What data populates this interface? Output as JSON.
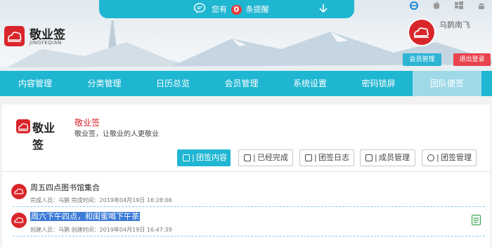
{
  "notification": {
    "prefix": "您有",
    "count": "0",
    "suffix": "条提醒"
  },
  "brand": {
    "name": "敬业签",
    "sub": "JINGYEQIAN"
  },
  "os_icons": [
    "ie-icon",
    "apple-icon",
    "windows-icon",
    "android-icon"
  ],
  "user": {
    "name": "乌鹊南飞",
    "member_button": "会员管理",
    "logout_button": "退出登录"
  },
  "nav": {
    "items": [
      "内容管理",
      "分类管理",
      "日历总览",
      "会员管理",
      "系统设置",
      "密码锁屏",
      "团队便签"
    ],
    "active_index": 6
  },
  "app": {
    "name": "敬业签",
    "desc": "敬业签，让敬业的人更敬业",
    "logo_text": "敬业签"
  },
  "tabs": [
    {
      "label": "团签内容",
      "active": true
    },
    {
      "label": "已经完成",
      "active": false
    },
    {
      "label": "团签日志",
      "active": false
    },
    {
      "label": "成员管理",
      "active": false
    },
    {
      "label": "团签管理",
      "active": false
    }
  ],
  "notes": [
    {
      "title": "周五四点图书馆集合",
      "meta": "完成人员：乌鹊  完成时间：2019年04月19日 16:28:06",
      "selected": false
    },
    {
      "title": "周六下午四点，和闺蜜喝下午茶",
      "meta": "创建人员：乌鹊  创建时间：2019年04月19日 16:47:39",
      "selected": true
    }
  ],
  "colors": {
    "accent": "#1fb6d2",
    "brand_red": "#d9262b",
    "logout": "#e8424e",
    "selection": "#3b7bd6"
  }
}
